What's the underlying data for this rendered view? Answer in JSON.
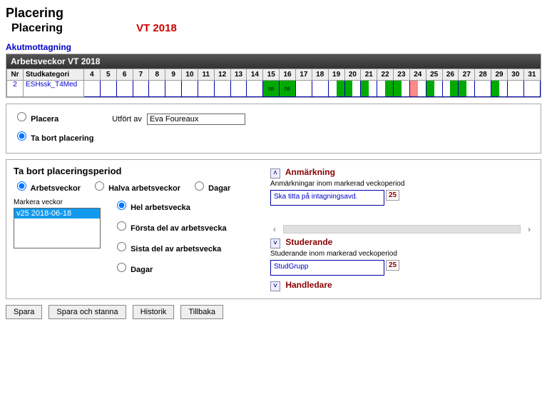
{
  "page": {
    "title": "Placering",
    "subtitle": "Placering",
    "term": "VT 2018",
    "unit": "Akutmottagning"
  },
  "weeks_panel": {
    "header": "Arbetsveckor VT 2018",
    "cols": {
      "nr": "Nr",
      "cat": "Studkategori",
      "weeks": [
        "4",
        "5",
        "6",
        "7",
        "8",
        "9",
        "10",
        "11",
        "12",
        "13",
        "14",
        "15",
        "16",
        "17",
        "18",
        "19",
        "20",
        "21",
        "22",
        "23",
        "24",
        "25",
        "26",
        "27",
        "28",
        "29",
        "30",
        "31"
      ]
    },
    "rows": [
      {
        "nr": "2",
        "cat": "ESHssk_T4Med",
        "cells": {
          "15": {
            "type": "re",
            "text": "re"
          },
          "16": {
            "type": "re",
            "text": "re"
          },
          "19": {
            "type": "half",
            "left": "",
            "right": "g"
          },
          "20": {
            "type": "half",
            "left": "g",
            "right": ""
          },
          "21": {
            "type": "half",
            "left": "g",
            "right": ""
          },
          "22": {
            "type": "half",
            "left": "",
            "right": "g"
          },
          "23": {
            "type": "half",
            "left": "g",
            "right": ""
          },
          "24": {
            "type": "half",
            "left": "r",
            "right": ""
          },
          "25": {
            "type": "half",
            "left": "g",
            "right": ""
          },
          "26": {
            "type": "half",
            "left": "",
            "right": "g"
          },
          "27": {
            "type": "half",
            "left": "g",
            "right": ""
          },
          "29": {
            "type": "half",
            "left": "g",
            "right": ""
          }
        }
      }
    ]
  },
  "mode": {
    "placera": "Placera",
    "tabort": "Ta bort placering",
    "utfort_label": "Utfört av",
    "utfort_value": "Eva Foureaux"
  },
  "remove": {
    "title": "Ta bort placeringsperiod",
    "scope": {
      "arbetsveckor": "Arbetsveckor",
      "halva": "Halva arbetsveckor",
      "dagar": "Dagar"
    },
    "markera_label": "Markera veckor",
    "list_items": [
      "v25 2018-06-18"
    ],
    "part": {
      "hel": "Hel arbetsvecka",
      "forsta": "Första del av arbetsvecka",
      "sista": "Sista del av arbetsvecka",
      "dagar": "Dagar"
    }
  },
  "right": {
    "anm_head": "Anmärkning",
    "anm_label": "Anmärkningar inom markerad veckoperiod",
    "anm_text": "Ska titta på intagningsavd.",
    "anm_week": "25",
    "stud_head": "Studerande",
    "stud_label": "Studerande inom markerad veckoperiod",
    "stud_text": "StudGrupp",
    "stud_week": "25",
    "hand_head": "Handledare"
  },
  "buttons": {
    "spara": "Spara",
    "spara_stanna": "Spara och stanna",
    "historik": "Historik",
    "tillbaka": "Tillbaka"
  }
}
